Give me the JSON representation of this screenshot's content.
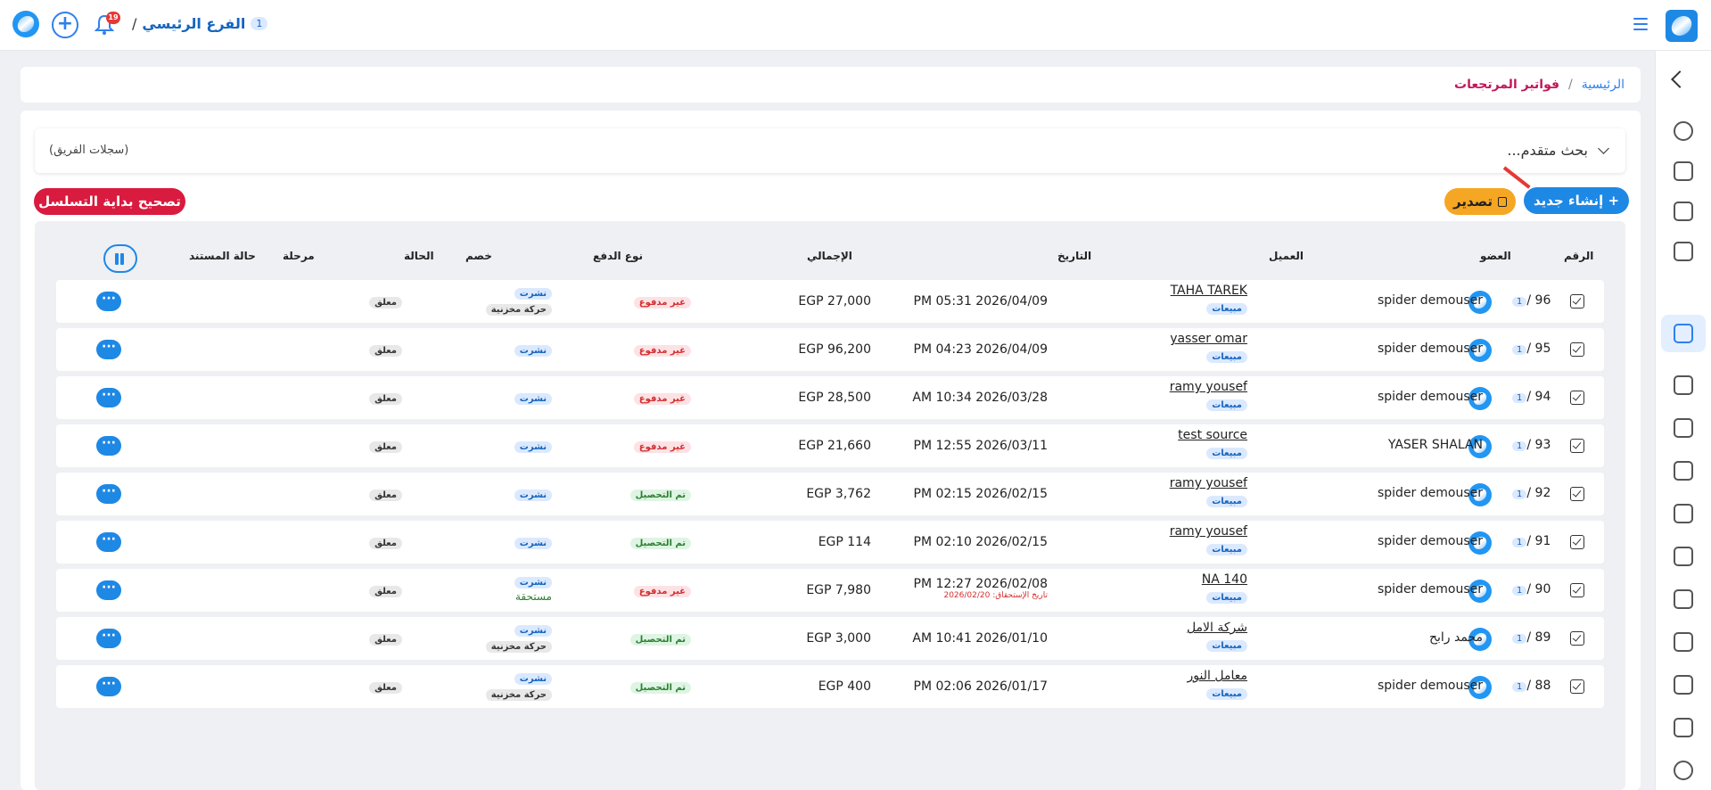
{
  "topbar": {
    "branch_name": "الفرع الرئيسي",
    "branch_number": "1",
    "notification_count": "19"
  },
  "breadcrumb": {
    "home": "الرئيسية",
    "separator": "/",
    "current": "فواتير المرتجعات"
  },
  "search": {
    "label": "بحث متقدم...",
    "team_records": "(سجلات الفريق)"
  },
  "actions": {
    "create_new": "+ إنشاء جديد",
    "export": "تصدير",
    "fix_sequence": "تصحيح بداية التسلسل"
  },
  "table": {
    "headers": {
      "number": "الرقم",
      "member": "العضو",
      "client": "العميل",
      "date": "التاريخ",
      "total": "الإجمالي",
      "payment_type": "نوع الدفع",
      "discount": "خصم",
      "status": "الحالة",
      "stage": "مرحلة",
      "doc_status": "حالة المستند"
    },
    "rows": [
      {
        "num": "96",
        "branch": "1",
        "member": "spider demouser",
        "client": "TAHA TAREK",
        "client_tag": "مبيعات",
        "date": "PM 05:31 2026/04/09",
        "due": "",
        "total": "EGP 27,000",
        "payment": "غير مدفوع",
        "status1": "نشرت",
        "status2": "حركة مخزنية",
        "doc_status": "معلق"
      },
      {
        "num": "95",
        "branch": "1",
        "member": "spider demouser",
        "client": "yasser omar",
        "client_tag": "مبيعات",
        "date": "PM 04:23 2026/04/09",
        "due": "",
        "total": "EGP 96,200",
        "payment": "غير مدفوع",
        "status1": "نشرت",
        "status2": "",
        "doc_status": "معلق"
      },
      {
        "num": "94",
        "branch": "1",
        "member": "spider demouser",
        "client": "ramy yousef",
        "client_tag": "مبيعات",
        "date": "AM 10:34 2026/03/28",
        "due": "",
        "total": "EGP 28,500",
        "payment": "غير مدفوع",
        "status1": "نشرت",
        "status2": "",
        "doc_status": "معلق"
      },
      {
        "num": "93",
        "branch": "1",
        "member": "YASER SHALAN",
        "client": "test source",
        "client_tag": "مبيعات",
        "date": "PM 12:55 2026/03/11",
        "due": "",
        "total": "EGP 21,660",
        "payment": "غير مدفوع",
        "status1": "نشرت",
        "status2": "",
        "doc_status": "معلق"
      },
      {
        "num": "92",
        "branch": "1",
        "member": "spider demouser",
        "client": "ramy yousef",
        "client_tag": "مبيعات",
        "date": "PM 02:15 2026/02/15",
        "due": "",
        "total": "EGP 3,762",
        "payment": "تم التحصيل",
        "status1": "نشرت",
        "status2": "",
        "doc_status": "معلق"
      },
      {
        "num": "91",
        "branch": "1",
        "member": "spider demouser",
        "client": "ramy yousef",
        "client_tag": "مبيعات",
        "date": "PM 02:10 2026/02/15",
        "due": "",
        "total": "EGP 114",
        "payment": "تم التحصيل",
        "status1": "نشرت",
        "status2": "",
        "doc_status": "معلق"
      },
      {
        "num": "90",
        "branch": "1",
        "member": "spider demouser",
        "client": "NA 140",
        "client_tag": "مبيعات",
        "date": "PM 12:27 2026/02/08",
        "due": "تاريخ الإستحقاق: 2026/02/20",
        "total": "EGP 7,980",
        "payment": "غير مدفوع",
        "status1": "نشرت",
        "status2": "مستحقة",
        "doc_status": "معلق"
      },
      {
        "num": "89",
        "branch": "1",
        "member": "محمد رابح",
        "client": "شركة الامل",
        "client_tag": "مبيعات",
        "date": "AM 10:41 2026/01/10",
        "due": "",
        "total": "EGP 3,000",
        "payment": "تم التحصيل",
        "status1": "نشرت",
        "status2": "حركة مخزنية",
        "doc_status": "معلق"
      },
      {
        "num": "88",
        "branch": "1",
        "member": "spider demouser",
        "client": "معامل النور",
        "client_tag": "مبيعات",
        "date": "PM 02:06 2026/01/17",
        "due": "",
        "total": "EGP 400",
        "payment": "تم التحصيل",
        "status1": "نشرت",
        "status2": "حركة مخزنية",
        "doc_status": "معلق"
      }
    ]
  },
  "colors": {
    "accent": "#1e88e5",
    "danger": "#d81b3f",
    "warning": "#f5a623",
    "unpaid": "#d32f2f",
    "paid": "#2e7d32"
  }
}
